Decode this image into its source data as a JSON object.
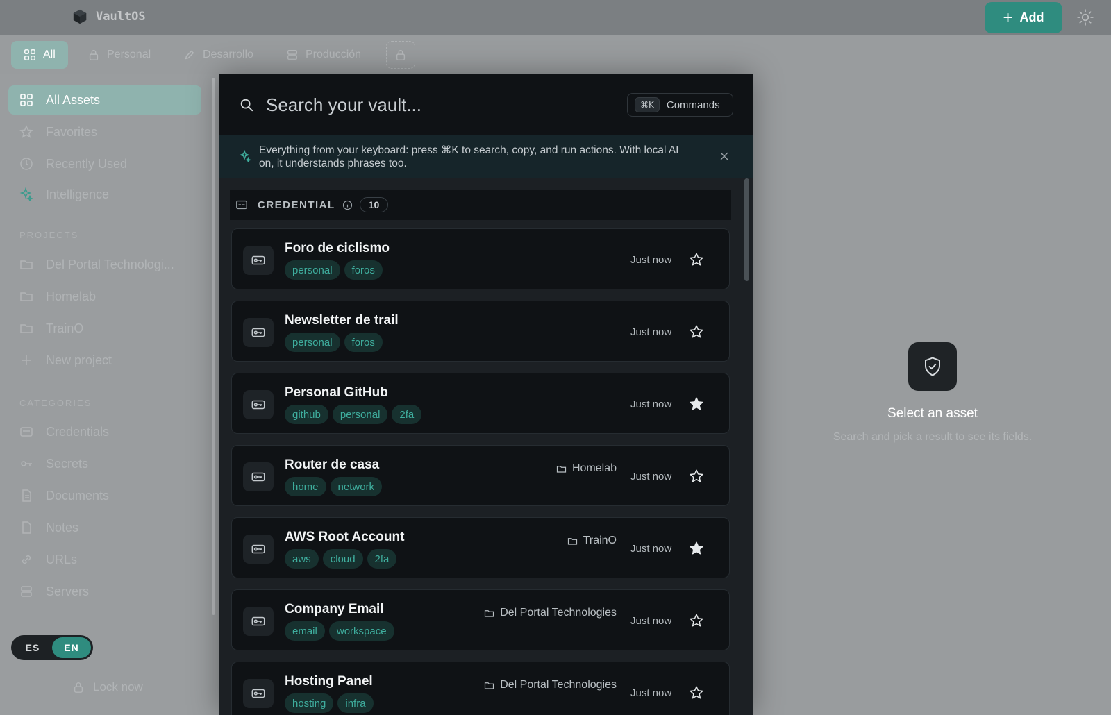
{
  "app": {
    "name": "VaultOS"
  },
  "header": {
    "add_label": "Add"
  },
  "tabs": [
    {
      "label": "All",
      "icon": "grid-icon"
    },
    {
      "label": "Personal",
      "icon": "lock-icon"
    },
    {
      "label": "Desarrollo",
      "icon": "pencil-icon"
    },
    {
      "label": "Producción",
      "icon": "server-icon"
    }
  ],
  "sidebar": {
    "nav": [
      {
        "label": "All Assets",
        "icon": "grid-icon"
      },
      {
        "label": "Favorites",
        "icon": "star-icon"
      },
      {
        "label": "Recently Used",
        "icon": "clock-icon"
      },
      {
        "label": "Intelligence",
        "icon": "sparkle-icon"
      }
    ],
    "projects_heading": "PROJECTS",
    "projects": [
      {
        "label": "Del Portal Technologi..."
      },
      {
        "label": "Homelab"
      },
      {
        "label": "TrainO"
      }
    ],
    "new_project_label": "New project",
    "categories_heading": "CATEGORIES",
    "categories": [
      {
        "label": "Credentials",
        "icon": "credential-icon"
      },
      {
        "label": "Secrets",
        "icon": "key-icon"
      },
      {
        "label": "Documents",
        "icon": "document-icon"
      },
      {
        "label": "Notes",
        "icon": "note-icon"
      },
      {
        "label": "URLs",
        "icon": "link-icon"
      },
      {
        "label": "Servers",
        "icon": "server-icon"
      }
    ],
    "lang": {
      "es": "ES",
      "en": "EN",
      "selected": "EN"
    },
    "lock_label": "Lock now"
  },
  "detail": {
    "empty_title": "Select an asset",
    "empty_subtitle": "Search and pick a result to see its fields."
  },
  "palette": {
    "search_placeholder": "Search your vault...",
    "search_value": "",
    "shortcut": "⌘K",
    "commands_label": "Commands",
    "tip": "Everything from your keyboard: press ⌘K to search, copy, and run actions. With local AI on, it understands phrases too.",
    "section": {
      "title": "CREDENTIAL",
      "count": "10"
    },
    "results": [
      {
        "title": "Foro de ciclismo",
        "tags": [
          "personal",
          "foros"
        ],
        "project": "",
        "time": "Just now",
        "favorite": false
      },
      {
        "title": "Newsletter de trail",
        "tags": [
          "personal",
          "foros"
        ],
        "project": "",
        "time": "Just now",
        "favorite": false
      },
      {
        "title": "Personal GitHub",
        "tags": [
          "github",
          "personal",
          "2fa"
        ],
        "project": "",
        "time": "Just now",
        "favorite": true
      },
      {
        "title": "Router de casa",
        "tags": [
          "home",
          "network"
        ],
        "project": "Homelab",
        "time": "Just now",
        "favorite": false
      },
      {
        "title": "AWS Root Account",
        "tags": [
          "aws",
          "cloud",
          "2fa"
        ],
        "project": "TrainO",
        "time": "Just now",
        "favorite": true
      },
      {
        "title": "Company Email",
        "tags": [
          "email",
          "workspace"
        ],
        "project": "Del Portal Technologies",
        "time": "Just now",
        "favorite": false
      },
      {
        "title": "Hosting Panel",
        "tags": [
          "hosting",
          "infra"
        ],
        "project": "Del Portal Technologies",
        "time": "Just now",
        "favorite": false
      }
    ]
  },
  "colors": {
    "accent": "#2f8c7f",
    "tag_bg": "#17312f",
    "tag_text": "#3fae9e",
    "card_bg": "#0f1215"
  }
}
